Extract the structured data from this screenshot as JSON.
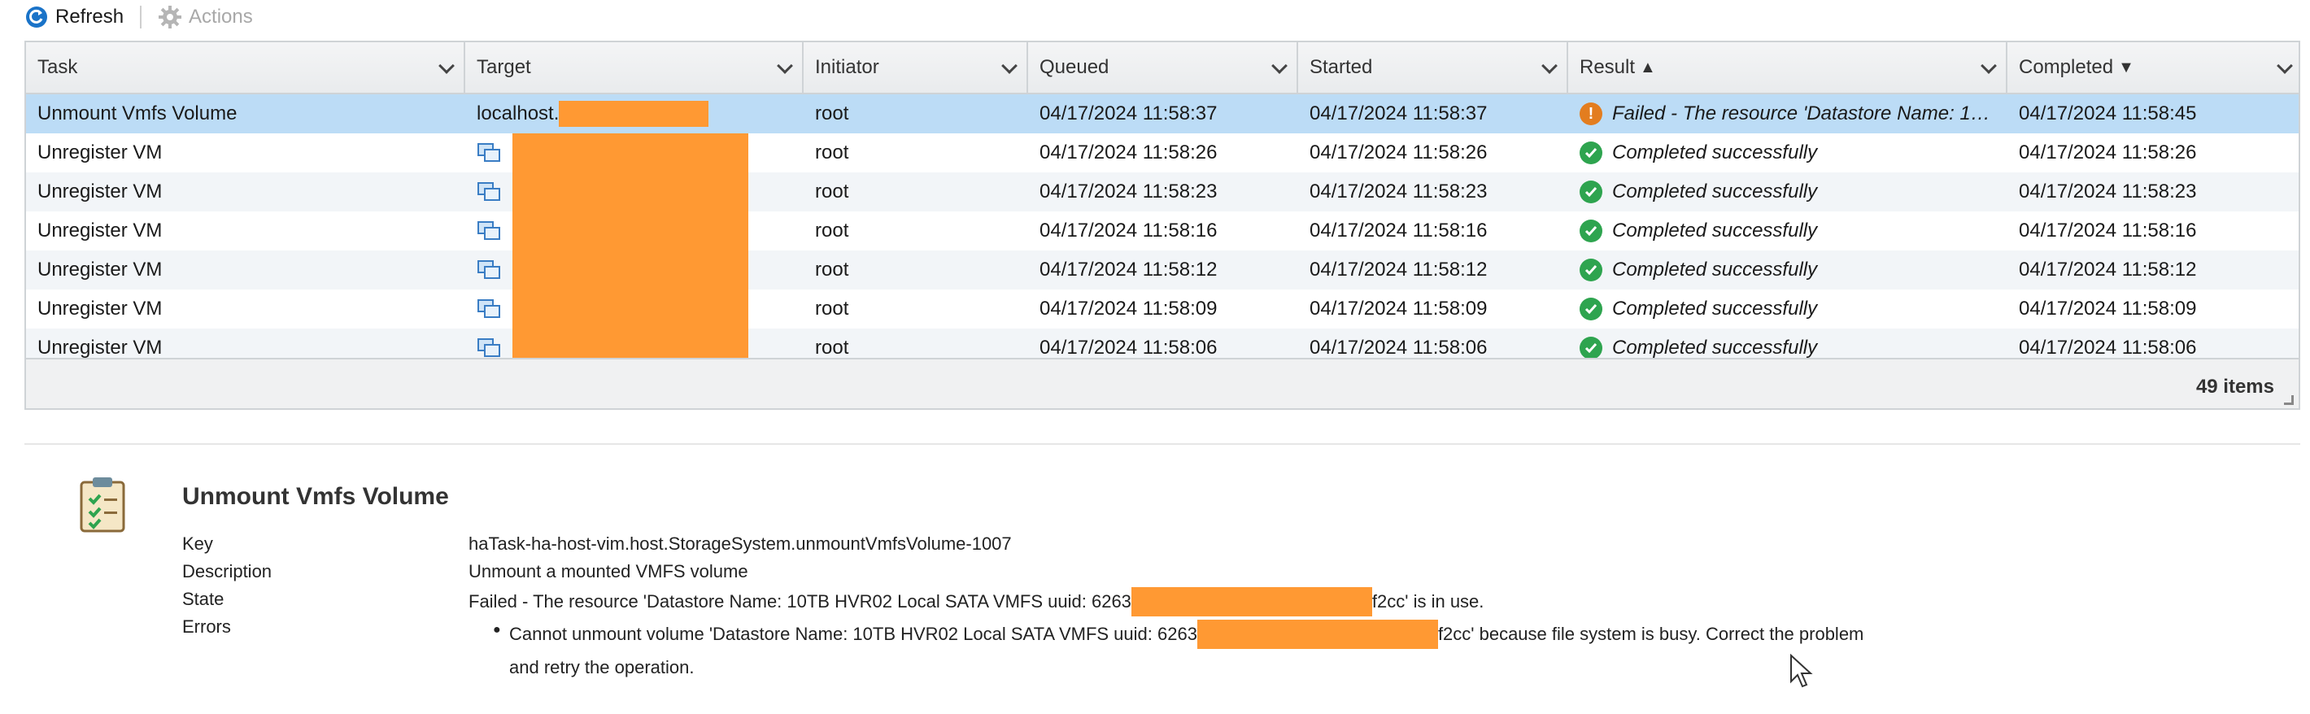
{
  "toolbar": {
    "refresh_label": "Refresh",
    "actions_label": "Actions"
  },
  "columns": [
    {
      "key": "task",
      "label": "Task",
      "sort": ""
    },
    {
      "key": "target",
      "label": "Target",
      "sort": ""
    },
    {
      "key": "initiator",
      "label": "Initiator",
      "sort": ""
    },
    {
      "key": "queued",
      "label": "Queued",
      "sort": ""
    },
    {
      "key": "started",
      "label": "Started",
      "sort": ""
    },
    {
      "key": "result",
      "label": "Result",
      "sort": "▲"
    },
    {
      "key": "completed",
      "label": "Completed",
      "sort": "▼"
    }
  ],
  "rows": [
    {
      "task": "Unmount Vmfs Volume",
      "target": "localhost.",
      "target_icon": "",
      "initiator": "root",
      "queued": "04/17/2024 11:58:37",
      "started": "04/17/2024 11:58:37",
      "result": "Failed - The resource 'Datastore Name: 1…",
      "result_status": "failed",
      "completed": "04/17/2024 11:58:45"
    },
    {
      "task": "Unregister VM",
      "target": "",
      "target_icon": "vm-icon",
      "initiator": "root",
      "queued": "04/17/2024 11:58:26",
      "started": "04/17/2024 11:58:26",
      "result": "Completed successfully",
      "result_status": "success",
      "completed": "04/17/2024 11:58:26"
    },
    {
      "task": "Unregister VM",
      "target": "",
      "target_icon": "vm-icon",
      "initiator": "root",
      "queued": "04/17/2024 11:58:23",
      "started": "04/17/2024 11:58:23",
      "result": "Completed successfully",
      "result_status": "success",
      "completed": "04/17/2024 11:58:23"
    },
    {
      "task": "Unregister VM",
      "target": "",
      "target_icon": "vm-icon",
      "initiator": "root",
      "queued": "04/17/2024 11:58:16",
      "started": "04/17/2024 11:58:16",
      "result": "Completed successfully",
      "result_status": "success",
      "completed": "04/17/2024 11:58:16"
    },
    {
      "task": "Unregister VM",
      "target": "",
      "target_icon": "vm-icon",
      "initiator": "root",
      "queued": "04/17/2024 11:58:12",
      "started": "04/17/2024 11:58:12",
      "result": "Completed successfully",
      "result_status": "success",
      "completed": "04/17/2024 11:58:12"
    },
    {
      "task": "Unregister VM",
      "target": "",
      "target_icon": "vm-icon",
      "initiator": "root",
      "queued": "04/17/2024 11:58:09",
      "started": "04/17/2024 11:58:09",
      "result": "Completed successfully",
      "result_status": "success",
      "completed": "04/17/2024 11:58:09"
    },
    {
      "task": "Unregister VM",
      "target": "",
      "target_icon": "vm-icon",
      "initiator": "root",
      "queued": "04/17/2024 11:58:06",
      "started": "04/17/2024 11:58:06",
      "result": "Completed successfully",
      "result_status": "success",
      "completed": "04/17/2024 11:58:06"
    }
  ],
  "footer": {
    "items_label": "49 items"
  },
  "detail": {
    "title": "Unmount Vmfs Volume",
    "key_label": "Key",
    "key_value": "haTask-ha-host-vim.host.StorageSystem.unmountVmfsVolume-1007",
    "description_label": "Description",
    "description_value": "Unmount a mounted VMFS volume",
    "state_label": "State",
    "state_prefix": "Failed - The resource 'Datastore Name: 10TB HVR02 Local SATA VMFS uuid: 6263",
    "state_suffix": "f2cc' is in use.",
    "errors_label": "Errors",
    "error_prefix": "Cannot unmount volume 'Datastore Name: 10TB HVR02 Local SATA VMFS uuid: 6263",
    "error_suffix": "f2cc' because file system is busy. Correct the problem",
    "error_line2": "and retry the operation."
  },
  "colors": {
    "selected_row": "#bcdcf6",
    "alt_row": "#f2f5f8",
    "redaction": "#ff9933",
    "success": "#2ea44f",
    "warning": "#e37d1f",
    "refresh_icon": "#1a73c8"
  }
}
